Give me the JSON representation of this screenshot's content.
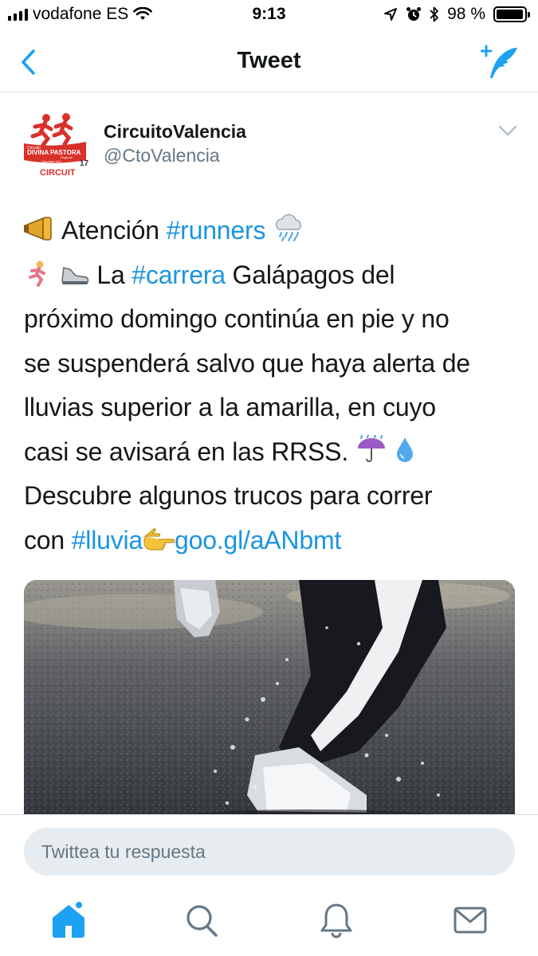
{
  "status_bar": {
    "carrier": "vodafone ES",
    "time": "9:13",
    "battery_percent": "98 %",
    "battery_level": 0.98
  },
  "nav": {
    "title": "Tweet"
  },
  "tweet": {
    "author_name": "CircuitoValencia",
    "author_handle": "@CtoValencia",
    "avatar_text": {
      "line1": "Circuito",
      "line2": "DIVINA PASTORA",
      "line3": "Seguros",
      "line4": "Deportes VLC",
      "line5": "CIRCUIT",
      "number": "17"
    },
    "lines": {
      "l1_a": "Atención ",
      "l1_tag": "#runners",
      "l2_a": " La ",
      "l2_tag": "#carrera",
      "l2_b": " Galápagos del",
      "l3": "próximo domingo continúa en pie y no",
      "l4": "se suspenderá salvo que  haya alerta de",
      "l5": "lluvias superior a la amarilla, en cuyo",
      "l6": "casi se avisará en las RRSS.",
      "l7": "Descubre algunos trucos para correr",
      "l8_a": "con ",
      "l8_tag": "#lluvia",
      "l8_link": "goo.gl/aANbmt"
    }
  },
  "reply": {
    "placeholder": "Twittea tu respuesta"
  },
  "tabs": [
    "home",
    "search",
    "notifications",
    "messages"
  ],
  "colors": {
    "accent": "#1da1f2",
    "link": "#1b95e0",
    "avatar_red": "#d8312a"
  },
  "icons": {
    "status": [
      "signal-icon",
      "wifi-icon",
      "location-icon",
      "alarm-icon",
      "bluetooth-icon",
      "battery-icon"
    ],
    "nav": [
      "back-chevron-icon",
      "compose-tweet-icon"
    ],
    "emoji": [
      "megaphone-icon",
      "rain-cloud-icon",
      "runner-icon",
      "sneaker-icon",
      "umbrella-rain-icon",
      "droplet-icon",
      "pointing-hand-icon"
    ],
    "tabs": [
      "home-icon",
      "search-icon",
      "bell-icon",
      "mail-icon"
    ]
  }
}
